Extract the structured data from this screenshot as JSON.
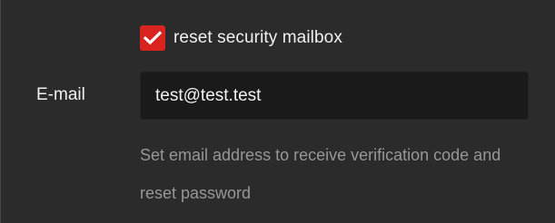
{
  "reset_mailbox": {
    "label": "reset security mailbox",
    "checked": true,
    "check_icon": "check-icon",
    "accent_color": "#d8231f"
  },
  "email": {
    "label": "E-mail",
    "value": "test@test.test"
  },
  "help_text": "Set email address to receive verification code and reset password"
}
